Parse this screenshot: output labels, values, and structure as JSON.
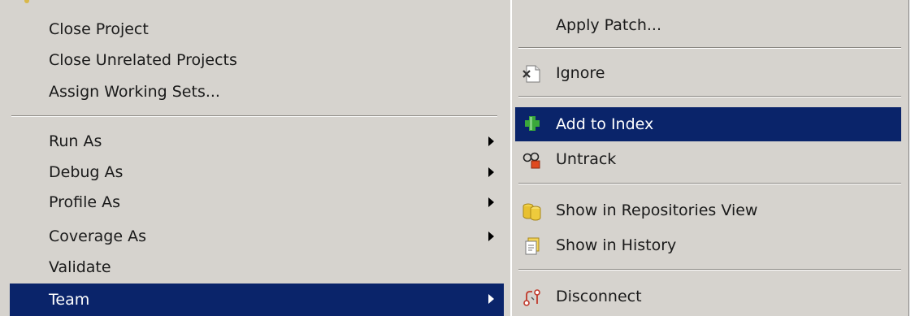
{
  "left_menu": {
    "items": [
      {
        "label": "Close Project"
      },
      {
        "label": "Close Unrelated Projects"
      },
      {
        "label": "Assign Working Sets..."
      },
      {
        "label": "Run As"
      },
      {
        "label": "Debug As"
      },
      {
        "label": "Profile As"
      },
      {
        "label": "Coverage As"
      },
      {
        "label": "Validate"
      },
      {
        "label": "Team"
      }
    ]
  },
  "team_submenu": {
    "items": [
      {
        "label": "Apply Patch..."
      },
      {
        "label": "Ignore",
        "icon": "ignore-icon"
      },
      {
        "label": "Add to Index",
        "icon": "add-plus-icon"
      },
      {
        "label": "Untrack",
        "icon": "untrack-icon"
      },
      {
        "label": "Show in Repositories View",
        "icon": "repositories-icon"
      },
      {
        "label": "Show in History",
        "icon": "history-icon"
      },
      {
        "label": "Disconnect",
        "icon": "disconnect-icon"
      }
    ]
  },
  "colors": {
    "menu_background": "#d6d3ce",
    "selection_background": "#0a246a",
    "selection_text": "#ffffff"
  }
}
